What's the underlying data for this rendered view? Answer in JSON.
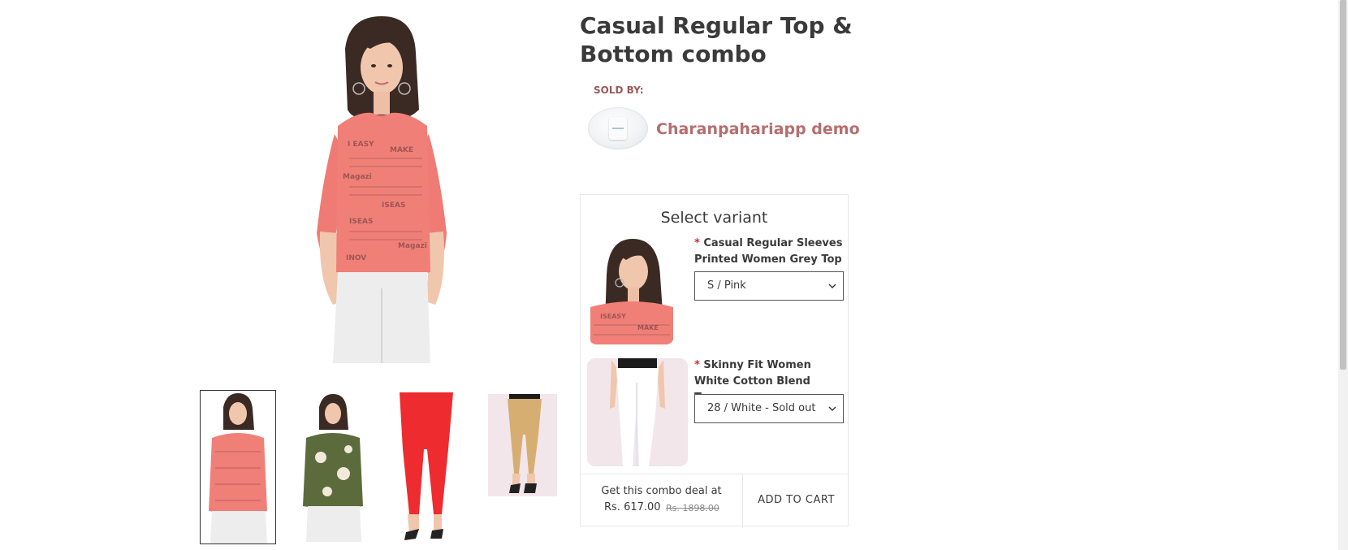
{
  "product": {
    "title": "Casual Regular Top & Bottom combo"
  },
  "seller": {
    "sold_by_label": "SOLD BY:",
    "name": "Charanpahariapp demo"
  },
  "gallery": {
    "thumbnails": [
      {
        "alt": "pink printed top",
        "selected": true
      },
      {
        "alt": "green floral top",
        "selected": false
      },
      {
        "alt": "red trousers",
        "selected": false
      },
      {
        "alt": "beige trousers",
        "selected": false
      }
    ]
  },
  "variant_selector": {
    "heading": "Select variant",
    "required_mark": "*",
    "items": [
      {
        "name": "Casual Regular Sleeves Printed Women Grey Top",
        "selected": "S / Pink"
      },
      {
        "name": "Skinny Fit Women White Cotton Blend Trousers",
        "selected": "28 / White - Sold out"
      }
    ]
  },
  "combo": {
    "deal_text": "Get this combo deal at",
    "price": "Rs. 617.00",
    "original_price": "Rs. 1898.00",
    "add_to_cart_label": "ADD TO CART"
  },
  "colors": {
    "seller_accent": "#b56e6e",
    "sold_by": "#9c5a5a",
    "required": "#d32f2f",
    "top_pink": "#f07f78"
  }
}
